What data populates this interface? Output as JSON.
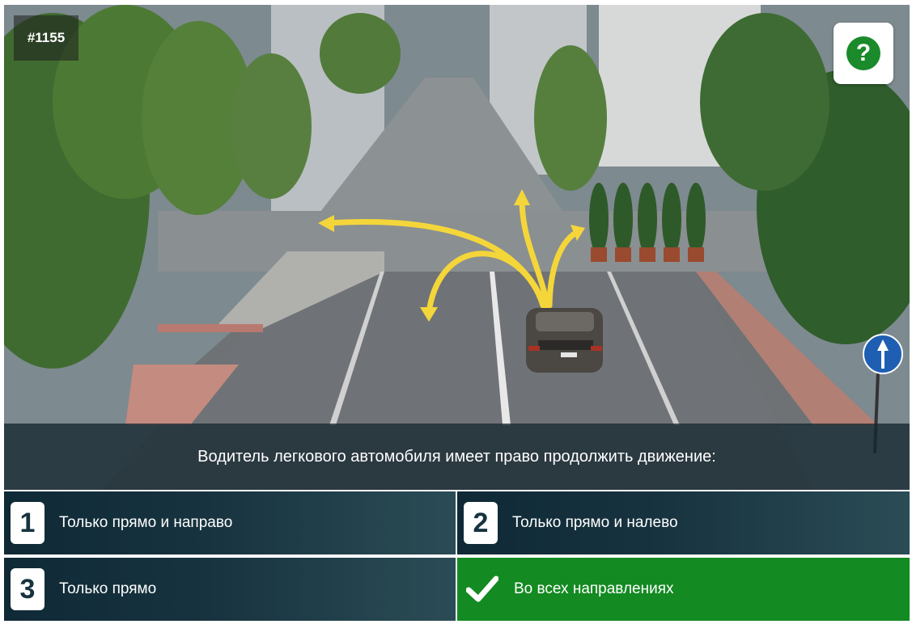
{
  "question": {
    "number": "#1155",
    "text": "Водитель легкового автомобиля имеет право продолжить движение:"
  },
  "help_button": {
    "icon": "question-icon",
    "glyph": "?",
    "color": "#1a8a2a"
  },
  "answers": [
    {
      "number": "1",
      "label": "Только прямо и направо",
      "state": "default"
    },
    {
      "number": "2",
      "label": "Только прямо и налево",
      "state": "default"
    },
    {
      "number": "3",
      "label": "Только прямо",
      "state": "default"
    },
    {
      "number": "",
      "icon": "checkmark-icon",
      "label": "Во всех направлениях",
      "state": "correct"
    }
  ],
  "colors": {
    "answer_default": "#17333f",
    "answer_correct": "#138a22",
    "question_bar": "#162630",
    "arrows": "#f4d63a"
  }
}
